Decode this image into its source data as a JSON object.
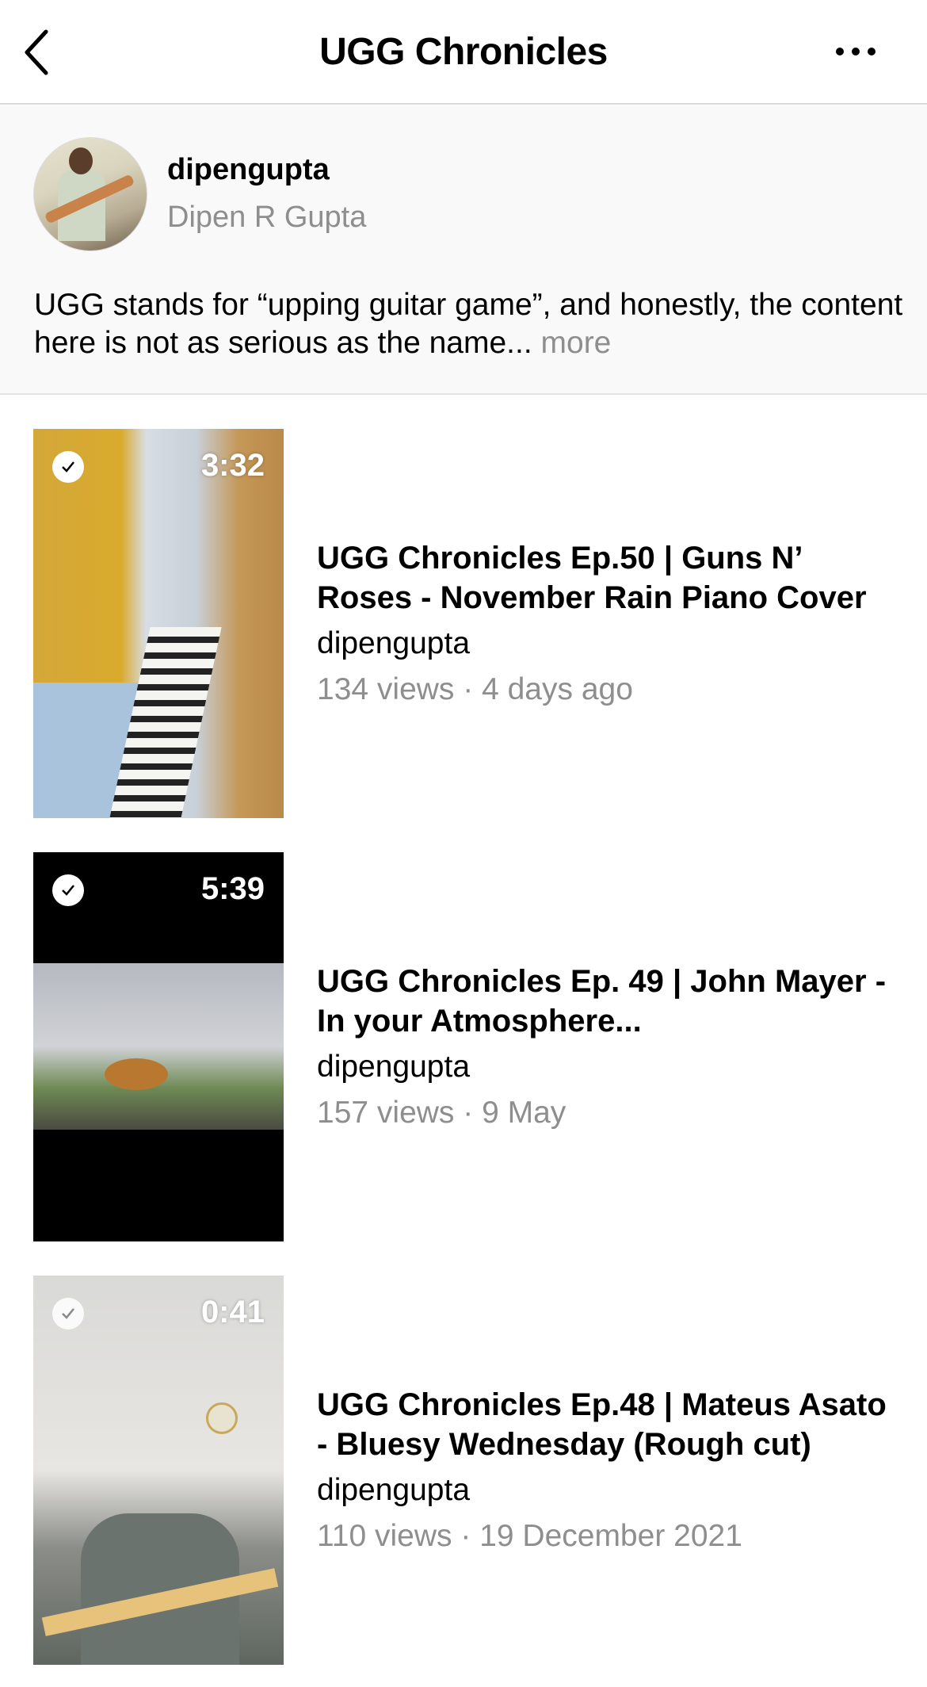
{
  "header": {
    "title": "UGG Chronicles",
    "back_icon": "chevron-left-icon",
    "more_icon": "ellipsis-icon"
  },
  "profile": {
    "username": "dipengupta",
    "full_name": "Dipen R Gupta",
    "description": "UGG stands for “upping guitar game”, and honestly, the content here is not as serious as the name...",
    "more_label": "more"
  },
  "videos": [
    {
      "duration": "3:32",
      "title": "UGG Chronicles Ep.50 | Guns N’ Roses - November Rain Piano Cover",
      "channel": "dipengupta",
      "meta": "134 views · 4 days ago",
      "watched": true
    },
    {
      "duration": "5:39",
      "title": "UGG Chronicles Ep. 49 | John Mayer - In your Atmosphere...",
      "channel": "dipengupta",
      "meta": "157 views · 9 May",
      "watched": true
    },
    {
      "duration": "0:41",
      "title": "UGG Chronicles Ep.48 | Mateus Asato - Bluesy Wednesday (Rough cut)",
      "channel": "dipengupta",
      "meta": "110 views · 19 December 2021",
      "watched": true
    }
  ]
}
